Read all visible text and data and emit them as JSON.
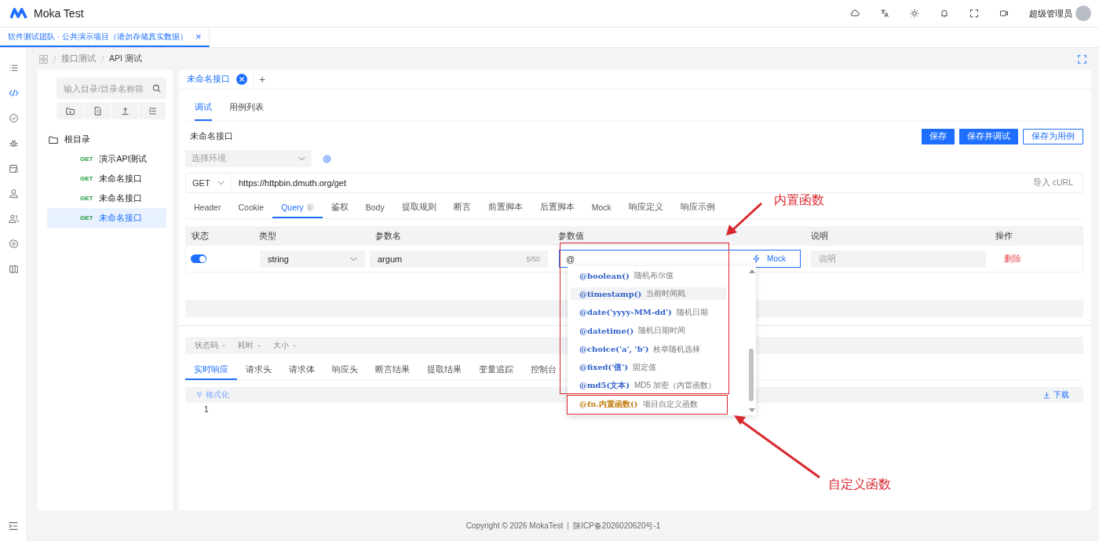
{
  "header": {
    "app_name": "Moka Test",
    "user": "超级管理员"
  },
  "header_icons": [
    {
      "kind": "cloud"
    },
    {
      "kind": "translate"
    },
    {
      "kind": "sun"
    },
    {
      "kind": "bell"
    },
    {
      "kind": "fullscreen"
    },
    {
      "kind": "video"
    }
  ],
  "project_tabs": [
    {
      "label": "软件测试团队 · 公共演示项目（请勿存储真实数据）",
      "close": "×",
      "selected": true
    }
  ],
  "rail": [
    {
      "kind": "list",
      "selected": false
    },
    {
      "kind": "code",
      "selected": true
    },
    {
      "kind": "check",
      "selected": false
    },
    {
      "kind": "bug",
      "selected": false
    },
    {
      "kind": "calendar",
      "selected": false
    },
    {
      "kind": "user",
      "selected": false
    },
    {
      "kind": "users",
      "selected": false
    },
    {
      "kind": "gear",
      "selected": false
    },
    {
      "kind": "map",
      "selected": false
    }
  ],
  "breadcrumb": [
    "接口测试",
    "API 测试"
  ],
  "tree": {
    "search_placeholder": "输入目录/目录名称筛",
    "tools": [
      {
        "kind": "folder"
      },
      {
        "kind": "file"
      },
      {
        "kind": "upload"
      },
      {
        "kind": "indent"
      }
    ],
    "root": "根目录",
    "children": [
      {
        "method": "GET",
        "name": "演示API测试",
        "selected": false
      },
      {
        "method": "GET",
        "name": "未命名接口",
        "selected": false
      },
      {
        "method": "GET",
        "name": "未命名接口",
        "selected": false
      },
      {
        "method": "GET",
        "name": "未命名接口",
        "selected": true
      }
    ]
  },
  "editor_tabs": [
    {
      "label": "未命名接口",
      "selected": true
    }
  ],
  "add_tab": "+",
  "sub_tabs": [
    {
      "label": "调试",
      "selected": true
    },
    {
      "label": "用例列表",
      "selected": false
    }
  ],
  "api_name": "未命名接口",
  "buttons": [
    {
      "label": "保存",
      "kind": "primary"
    },
    {
      "label": "保存并调试",
      "kind": "primary"
    },
    {
      "label": "保存为用例",
      "kind": "outline"
    }
  ],
  "environment": {
    "placeholder": "选择环境"
  },
  "request": {
    "method": "GET",
    "url": "https://httpbin.dmuth.org/get",
    "import": "导入 cURL"
  },
  "request_tabs": [
    {
      "label": "Header",
      "selected": false
    },
    {
      "label": "Cookie",
      "selected": false
    },
    {
      "label": "Query",
      "badge": "1",
      "selected": true
    },
    {
      "label": "鉴权",
      "selected": false
    },
    {
      "label": "Body",
      "selected": false
    },
    {
      "label": "提取规则",
      "selected": false
    },
    {
      "label": "断言",
      "selected": false
    },
    {
      "label": "前置脚本",
      "selected": false
    },
    {
      "label": "后置脚本",
      "selected": false
    },
    {
      "label": "Mock",
      "selected": false
    },
    {
      "label": "响应定义",
      "selected": false
    },
    {
      "label": "响应示例",
      "selected": false
    }
  ],
  "params": {
    "columns": [
      "状态",
      "类型",
      "参数名",
      "参数值",
      "说明",
      "操作"
    ],
    "rows": [
      {
        "on": true,
        "type": "string",
        "name": "argum",
        "count": "5/50",
        "value": "@",
        "mock": "Mock",
        "description_placeholder": "说明",
        "action": "删除"
      }
    ]
  },
  "suggestions": [
    {
      "func": "@boolean()",
      "desc": "随机布尔值",
      "kind": "builtin",
      "selected": false
    },
    {
      "func": "@timestamp()",
      "desc": "当前时间戳",
      "kind": "builtin",
      "selected": true
    },
    {
      "func": "@date('yyyy-MM-dd')",
      "desc": "随机日期",
      "kind": "builtin",
      "selected": false
    },
    {
      "func": "@datetime()",
      "desc": "随机日期时间",
      "kind": "builtin",
      "selected": false
    },
    {
      "func": "@choice('a', 'b')",
      "desc": "枚举随机选择",
      "kind": "builtin",
      "selected": false
    },
    {
      "func": "@fixed('值')",
      "desc": "固定值",
      "kind": "builtin",
      "selected": false
    },
    {
      "func": "@md5(文本)",
      "desc": "MD5 加密（内置函数）",
      "kind": "builtin",
      "selected": false
    },
    {
      "func": "@fn.内置函数()",
      "desc": "项目自定义函数",
      "kind": "custom",
      "selected": false
    }
  ],
  "response": {
    "status": [
      {
        "label": "状态码",
        "value": "-"
      },
      {
        "label": "耗时",
        "value": "-"
      },
      {
        "label": "大小",
        "value": "-"
      }
    ],
    "tabs": [
      {
        "label": "实时响应",
        "selected": true
      },
      {
        "label": "请求头",
        "selected": false
      },
      {
        "label": "请求体",
        "selected": false
      },
      {
        "label": "响应头",
        "selected": false
      },
      {
        "label": "断言结果",
        "selected": false
      },
      {
        "label": "提取结果",
        "selected": false
      },
      {
        "label": "变量追踪",
        "selected": false
      },
      {
        "label": "控制台",
        "selected": false
      }
    ],
    "format": "格式化",
    "download": "下载",
    "line_numbers": [
      "1"
    ]
  },
  "footer": {
    "copyright": "Copyright © 2026 MokaTest",
    "icp": "陕ICP备2026020620号-1"
  },
  "annotations": [
    {
      "label": "内置函数"
    },
    {
      "label": "自定义函数"
    }
  ]
}
